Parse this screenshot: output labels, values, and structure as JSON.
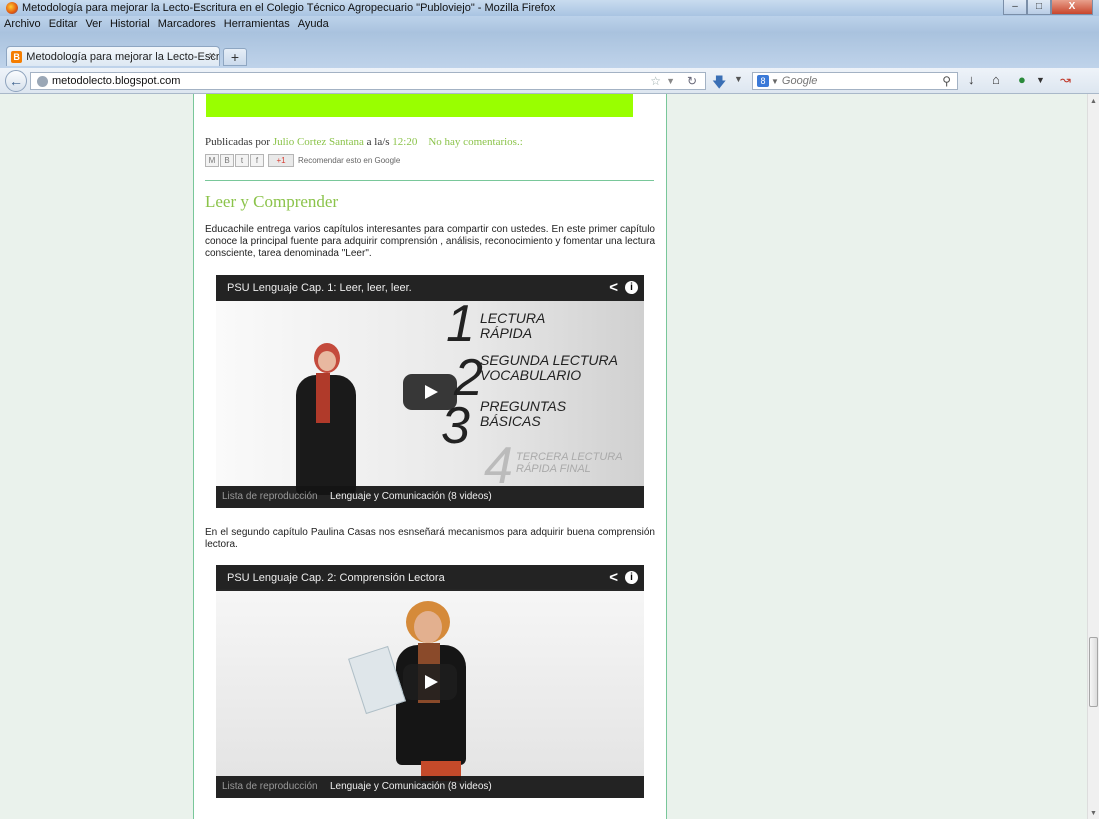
{
  "window": {
    "title": "Metodología para mejorar la Lecto-Escritura en el Colegio Técnico Agropecuario \"Publoviejo\" - Mozilla Firefox",
    "minimize": "–",
    "maximize": "□",
    "close": "X"
  },
  "menu": [
    "Archivo",
    "Editar",
    "Ver",
    "Historial",
    "Marcadores",
    "Herramientas",
    "Ayuda"
  ],
  "tab": {
    "label": "Metodología para mejorar la Lecto-Escri...",
    "icon": "B",
    "close": "×",
    "new_tab": "+"
  },
  "nav": {
    "url": "metodolecto.blogspot.com",
    "search_engine_icon": "8",
    "search_placeholder": "Google"
  },
  "post_meta": {
    "published_by": "Publicadas por",
    "author": "Julio Cortez Santana",
    "at": "a la/s",
    "time": "12:20",
    "comments": "No hay comentarios.:",
    "gplus": "+1",
    "recommend": "Recomendar esto en Google"
  },
  "post": {
    "title": "Leer y Comprender",
    "para1": "Educachile entrega varios capítulos interesantes para compartir con ustedes.  En este primer capítulo conoce la principal fuente para adquirir comprensión , análisis, reconocimiento y fomentar una lectura consciente, tarea denominada \"Leer\".",
    "para2": "En el segundo capítulo Paulina Casas nos esnseñará mecanismos para adquirir buena comprensión lectora."
  },
  "video1": {
    "title": "PSU Lenguaje Cap. 1: Leer, leer, leer.",
    "playlist_label": "Lista de reproducción",
    "playlist_name": "Lenguaje y Comunicación (8 videos)",
    "steps": [
      {
        "num": "1",
        "text": "LECTURA\nRÁPIDA"
      },
      {
        "num": "2",
        "text": "SEGUNDA LECTURA\nVOCABULARIO"
      },
      {
        "num": "3",
        "text": "PREGUNTAS\nBÁSICAS"
      },
      {
        "num": "4",
        "text": "TERCERA LECTURA\nRÁPIDA FINAL"
      }
    ]
  },
  "video2": {
    "title": "PSU Lenguaje Cap. 2: Comprensión Lectora",
    "playlist_label": "Lista de reproducción",
    "playlist_name": "Lenguaje y Comunicación (8 videos)"
  }
}
